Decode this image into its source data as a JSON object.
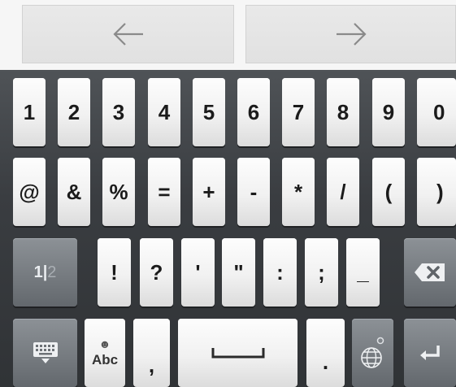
{
  "navigation": {
    "back": {
      "icon": "arrow-left-icon"
    },
    "forward": {
      "icon": "arrow-right-icon"
    }
  },
  "keyboard": {
    "row1": [
      "1",
      "2",
      "3",
      "4",
      "5",
      "6",
      "7",
      "8",
      "9",
      "0"
    ],
    "row2": [
      "@",
      "&",
      "%",
      "=",
      "+",
      "-",
      "*",
      "/",
      "(",
      ")"
    ],
    "row3": {
      "page_toggle": {
        "primary": "1|",
        "secondary": "2"
      },
      "keys": [
        "!",
        "?",
        "'",
        "\"",
        ":",
        ";",
        "_"
      ],
      "delete_icon": "backspace-icon"
    },
    "row4": {
      "keyboard_icon": "keyboard-icon",
      "abc_label": "Abc",
      "emoji_icon": "smiley-icon",
      "comma": ",",
      "space_icon": "space-bar-icon",
      "period": ".",
      "language_icon": "globe-icon",
      "enter_icon": "enter-icon"
    }
  },
  "colors": {
    "background": "#f6f6f6",
    "keyboard_bg": "#3a3d41",
    "key_light": "#f1f1f1",
    "key_dark": "#767b80",
    "key_text": "#1b1b1b"
  }
}
